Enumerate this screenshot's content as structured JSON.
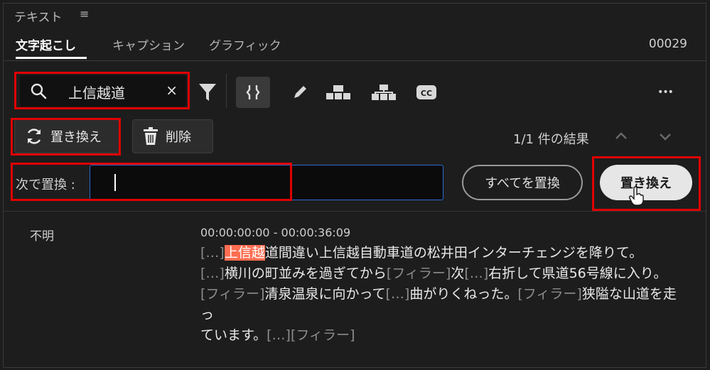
{
  "panel": {
    "title": "テキスト",
    "menu_icon": "≡"
  },
  "tabs": [
    {
      "label": "文字起こし",
      "active": true
    },
    {
      "label": "キャプション",
      "active": false
    },
    {
      "label": "グラフィック",
      "active": false
    }
  ],
  "counter": "00029",
  "search": {
    "value": "上信越道",
    "clear_glyph": "×",
    "icon": "search-icon"
  },
  "toolbar": {
    "icons": [
      "filter-icon",
      "split-segment-icon",
      "pencil-icon",
      "speaker-merge-icon",
      "speaker-split-icon",
      "cc-caption-icon",
      "more-icon"
    ],
    "cc_label": "CC",
    "more_glyph": "•••"
  },
  "actions": {
    "replace_label": "置き換え",
    "delete_label": "削除"
  },
  "results": {
    "text": "1/1 件の結果"
  },
  "replace": {
    "label": "次で置換 :",
    "value": "",
    "replace_all_label": "すべてを置換",
    "replace_one_label": "置き換え"
  },
  "transcript": {
    "speaker": "不明",
    "timecode": "00:00:00:00 - 00:00:36:09",
    "line1": {
      "f1": "[…]",
      "highlight": "上信越",
      "t1": "道間違い上信越自動車道の松井田インターチェンジを降りて。"
    },
    "line2": {
      "f1": "[…]",
      "t1": "横川の町並みを過ぎてから",
      "f2": "[フィラー]",
      "t2": "次",
      "f3": "[…]",
      "t3": "右折して県道56号線に入り。"
    },
    "line3": {
      "f1": "[フィラー]",
      "t1": "清泉温泉に向かって",
      "f2": "[…]",
      "t2": "曲がりくねった。",
      "f3": "[フィラー]",
      "t3": "狭隘な山道を走っ"
    },
    "line4": {
      "t1": "ています。",
      "f1": "[…]",
      "f2": "[フィラー]"
    }
  },
  "colors": {
    "highlight": "#ff6e52",
    "annotation_box": "#e00000",
    "input_focus": "#2c6cd5"
  }
}
